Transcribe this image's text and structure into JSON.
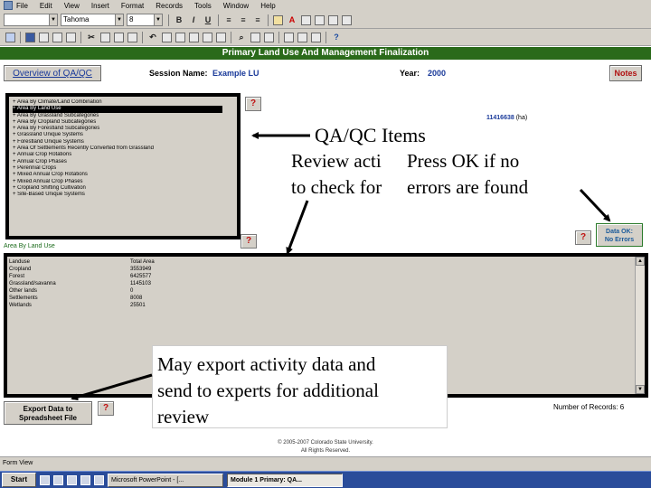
{
  "menu": [
    "File",
    "Edit",
    "View",
    "Insert",
    "Format",
    "Records",
    "Tools",
    "Window",
    "Help"
  ],
  "toolbar": {
    "font_name": "Tahoma",
    "font_size": "8",
    "bold_label": "B",
    "italic_label": "I",
    "underline_label": "U"
  },
  "form": {
    "title": "Primary Land Use And Management Finalization",
    "overview_button": "Overview of QA/QC",
    "session_label": "Session Name:",
    "session_value": "Example LU",
    "year_label": "Year:",
    "year_value": "2000",
    "notes_button": "Notes"
  },
  "qaqc": {
    "items": [
      "Area By Climate/Land Combination",
      "Area By Land Use",
      "Area By Grassland Subcategories",
      "Area By Cropland Subcategories",
      "Area By Forestland Subcategories",
      "Grassland Unique Systems",
      "Forestland Unique Systems",
      "Area Of Settlements Recently Converted from Grassland",
      "Annual Crop Rotations",
      "Annual Crop Phases",
      "Perennial Crops",
      "Mixed Annual Crop Rotations",
      "Mixed Annual Crop Phases",
      "Cropland Shifting Cultivation",
      "Site-Based Unique Systems"
    ],
    "selected_index": 1,
    "question_label": "?",
    "total_area_value": "11416638",
    "total_area_unit": "(ha)"
  },
  "land_use": {
    "label": "Area By Land Use",
    "data_ok_button_line1": "Data OK:",
    "data_ok_button_line2": "No Errors",
    "header": {
      "name": "Landuse",
      "value": "Total Area"
    },
    "rows": [
      {
        "name": "Cropland",
        "value": "3553949"
      },
      {
        "name": "Forest",
        "value": "6425577"
      },
      {
        "name": "Grassland/savanna",
        "value": "1145103"
      },
      {
        "name": "Other lands",
        "value": "0"
      },
      {
        "name": "Settlements",
        "value": "8008"
      },
      {
        "name": "Wetlands",
        "value": "25501"
      }
    ]
  },
  "footer": {
    "export_button_line1": "Export Data to",
    "export_button_line2": "Spreadsheet File",
    "records_label": "Number of Records: 6",
    "copyright_line1": "© 2005-2007 Colorado State University.",
    "copyright_line2": "All Rights Reserved."
  },
  "callouts": {
    "title": "QA/QC Items",
    "review_line1": "Review acti",
    "review_line2": "to check for",
    "ok_line1": "Press OK if no",
    "ok_line2": "errors are found",
    "export_line1": "May export activity data and",
    "export_line2": "send to experts for additional",
    "export_line3": "review"
  },
  "status": {
    "text": "Form View"
  },
  "taskbar": {
    "start": "Start",
    "tasks": [
      "Microsoft PowerPoint - [...",
      "Module 1 Primary: QA..."
    ]
  }
}
